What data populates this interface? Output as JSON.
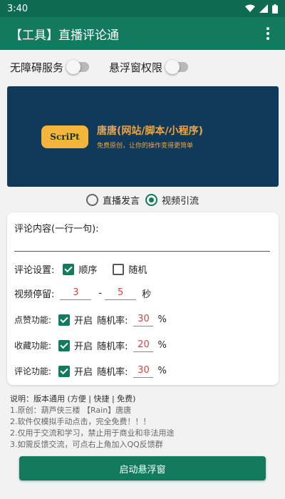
{
  "status": {
    "time": "3:40"
  },
  "app": {
    "title": "【工具】直播评论通"
  },
  "toggles": [
    {
      "label": "无障碍服务",
      "on": false
    },
    {
      "label": "悬浮窗权限",
      "on": false
    }
  ],
  "banner": {
    "logo_text": "ScriPt",
    "headline": "唐唐(网站/脚本/小程序)",
    "tagline": "免费原创，让你的操作变得更简单"
  },
  "mode": {
    "options": [
      "直播发言",
      "视频引流"
    ],
    "selected": "视频引流"
  },
  "form": {
    "comment_label": "评论内容(一行一句):",
    "comment_value": "",
    "settings_label": "评论设置:",
    "order_sequential": {
      "label": "顺序",
      "checked": true
    },
    "order_random": {
      "label": "随机",
      "checked": false
    },
    "stay_label": "视频停留:",
    "stay_min": "3",
    "stay_sep": "-",
    "stay_max": "5",
    "stay_unit": "秒",
    "features": [
      {
        "label": "点赞功能:",
        "enable_label": "开启",
        "enabled": true,
        "rate_label": "随机率:",
        "rate": "30",
        "unit": "%"
      },
      {
        "label": "收藏功能:",
        "enable_label": "开启",
        "enabled": true,
        "rate_label": "随机率:",
        "rate": "20",
        "unit": "%"
      },
      {
        "label": "评论功能:",
        "enable_label": "开启",
        "enabled": true,
        "rate_label": "随机率:",
        "rate": "30",
        "unit": "%"
      }
    ]
  },
  "notes": {
    "head": "说明：版本通用 (方便 | 快捷 | 免费)",
    "lines": [
      "1.原创：葫芦侠三楼 【Rain】唐唐",
      "2.软件仅模拟手动点击，完全免费！！！",
      "2.仅用于交流和学习，禁止用于商业和非法用途",
      "3.如需反馈交流，可点右上角加入QQ反馈群"
    ]
  },
  "start_button": "启动悬浮窗",
  "colors": {
    "primary": "#127a5d",
    "statusbar": "#0e6b52",
    "banner_bg": "#0f3a5c",
    "accent_orange": "#f3a43a",
    "number_red": "#d84040"
  }
}
